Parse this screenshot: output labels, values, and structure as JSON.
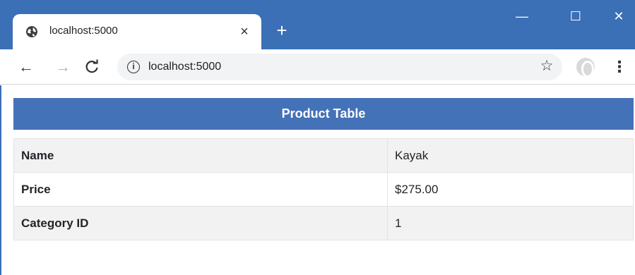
{
  "browser": {
    "tab": {
      "title": "localhost:5000",
      "close": "×",
      "favicon": "globe-icon"
    },
    "new_tab": "+",
    "window_controls": {
      "minimize": "—",
      "maximize": "☐",
      "close": "✕"
    },
    "nav": {
      "back": "←",
      "forward": "→",
      "reload": "C"
    },
    "address_bar": {
      "info": "i",
      "url": "localhost:5000"
    },
    "bookmark": "☆",
    "menu": "⋮"
  },
  "page": {
    "table_title": "Product Table",
    "rows": [
      {
        "label": "Name",
        "value": "Kayak"
      },
      {
        "label": "Price",
        "value": "$275.00"
      },
      {
        "label": "Category ID",
        "value": "1"
      }
    ]
  },
  "colors": {
    "titlebar": "#3b6fb6",
    "table_header": "#4472b8",
    "row_stripe": "#f2f2f2"
  }
}
